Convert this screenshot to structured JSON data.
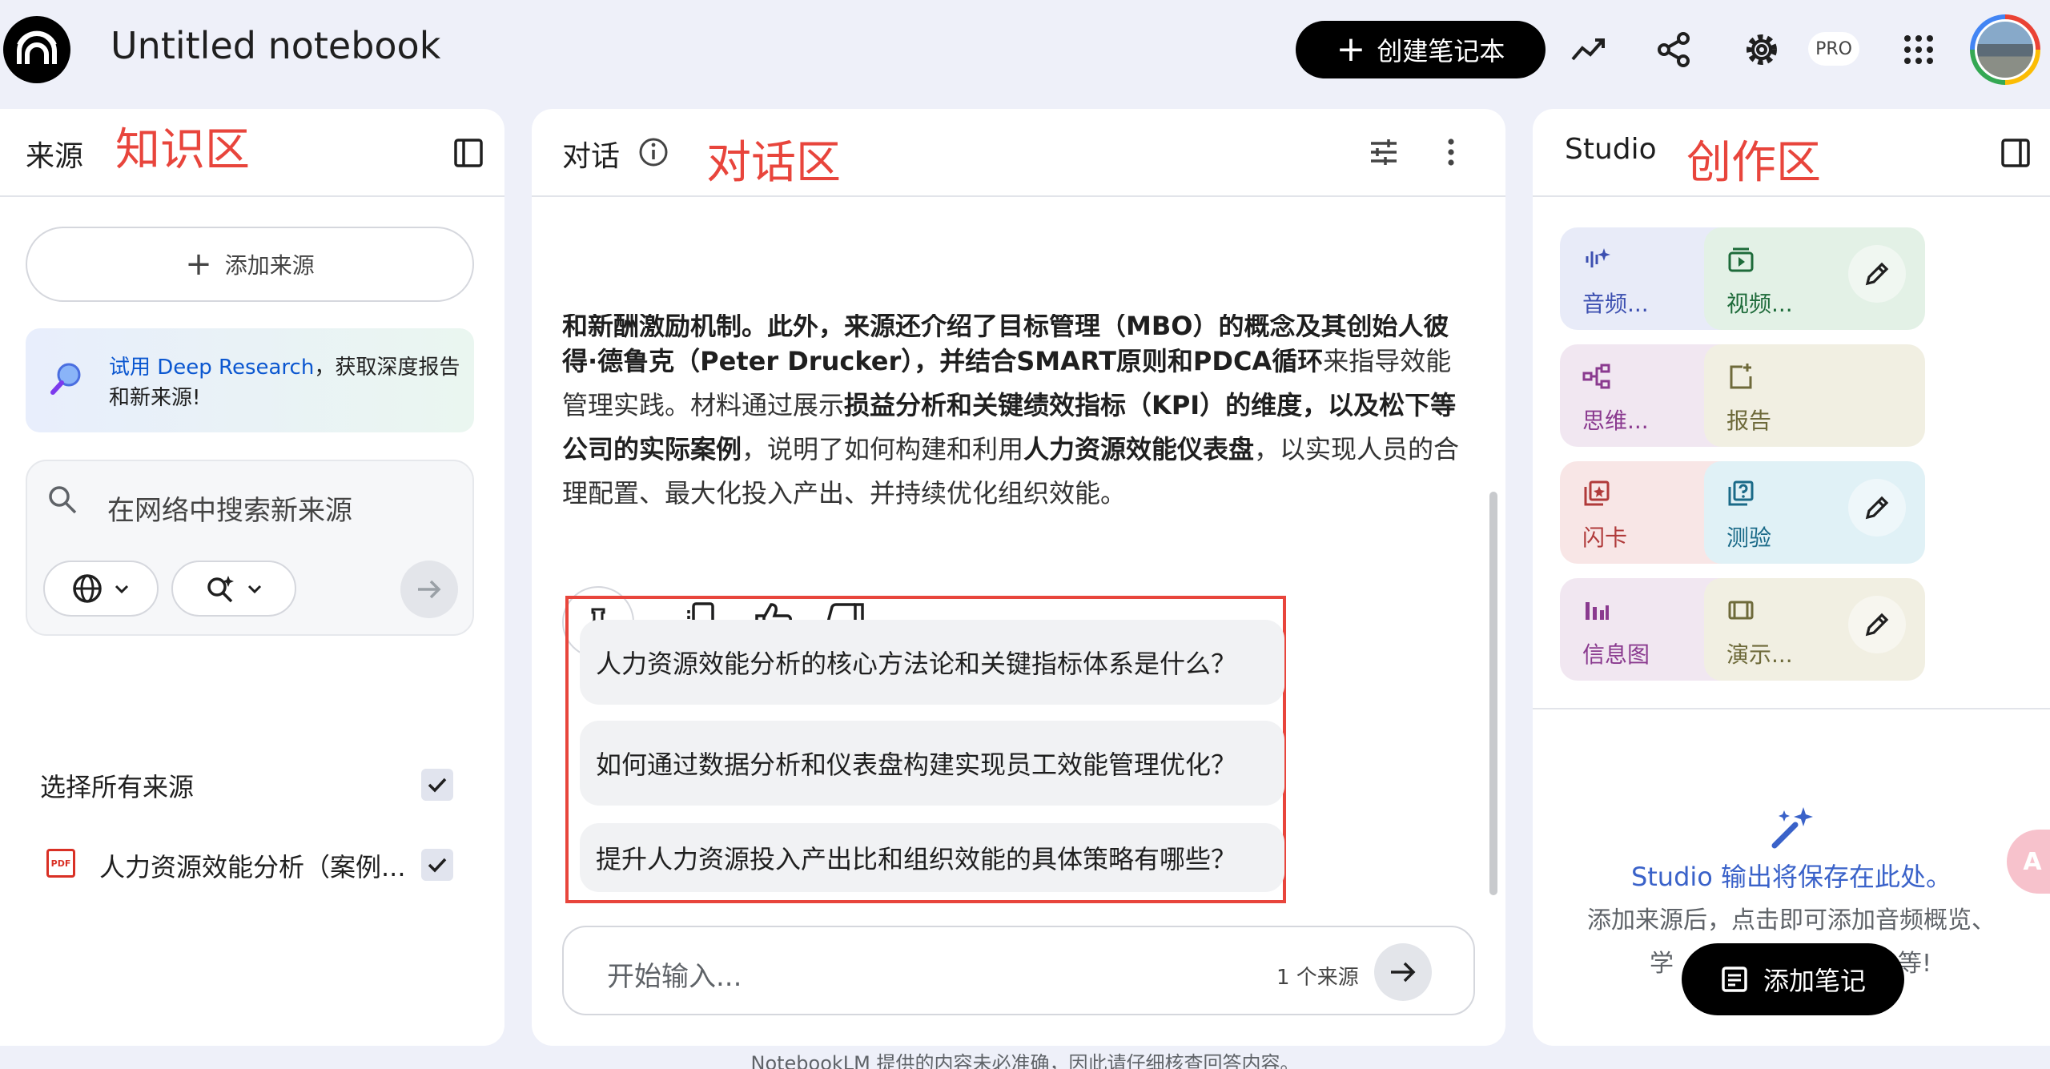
{
  "header": {
    "title": "Untitled notebook",
    "create_button": "创建笔记本",
    "pro_badge": "PRO",
    "icons": [
      "analytics-icon",
      "share-icon",
      "settings-icon",
      "apps-grid-icon"
    ]
  },
  "left_panel": {
    "title": "来源",
    "annotation": "知识区",
    "add_source": "添加来源",
    "deep_research": {
      "link": "试用 Deep Research",
      "text": "，获取深度报告和新来源!"
    },
    "search_placeholder": "在网络中搜索新来源",
    "select_all": "选择所有来源",
    "select_all_checked": true,
    "sources": [
      {
        "name": "人力资源效能分析（案例...",
        "type": "PDF",
        "checked": true
      }
    ]
  },
  "middle_panel": {
    "title": "对话",
    "annotation": "对话区",
    "answer_html_parts": {
      "line1": "和新酬激励机制。此外，来源还介绍了目标管理（MBO）的概念及其创始人彼",
      "p1": "得·德鲁克（Peter Drucker），并结合SMART原则和PDCA循环",
      "p2": "来指导效能管理实践。材料通过展示",
      "p3": "损益分析和关键绩效指标（KPI）的维度，以及松下等公司的实际案例",
      "p4": "，说明了如何构建和利用",
      "p5": "人力资源效能仪表盘",
      "p6": "，以实现人员的合理配置、最大化投入产出、并持续优化组织效能。"
    },
    "suggestions": [
      "人力资源效能分析的核心方法论和关键指标体系是什么？",
      "如何通过数据分析和仪表盘构建实现员工效能管理优化？",
      "提升人力资源投入产出比和组织效能的具体策略有哪些？"
    ],
    "input_placeholder": "开始输入...",
    "source_count": "1 个来源",
    "disclaimer": "NotebookLM 提供的内容未必准确，因此请仔细核查回答内容。"
  },
  "right_panel": {
    "title": "Studio",
    "annotation": "创作区",
    "cards": [
      {
        "label": "音频...",
        "icon": "audio-icon",
        "bg": "#e8ebf8",
        "color": "#3c4fb0"
      },
      {
        "label": "视频...",
        "icon": "video-icon",
        "bg": "#e3f1e6",
        "color": "#1e6b3a"
      },
      {
        "label": "思维...",
        "icon": "mindmap-icon",
        "bg": "#f1e7f1",
        "color": "#8a3a8f"
      },
      {
        "label": "报告",
        "icon": "report-icon",
        "bg": "#f1efe2",
        "color": "#6e6a3a"
      },
      {
        "label": "闪卡",
        "icon": "flashcard-icon",
        "bg": "#f8e6e6",
        "color": "#b03a3a"
      },
      {
        "label": "测验",
        "icon": "quiz-icon",
        "bg": "#e0f1f6",
        "color": "#1a6a88"
      },
      {
        "label": "信息图",
        "icon": "infographic-icon",
        "bg": "#f1e7f1",
        "color": "#8a3a8f"
      },
      {
        "label": "演示...",
        "icon": "slides-icon",
        "bg": "#f1efe2",
        "color": "#6e6a3a"
      }
    ],
    "empty_title": "Studio 输出将保存在此处。",
    "empty_line1": "添加来源后，点击即可添加音频概览、",
    "empty_line2a": "学",
    "empty_line2b": "等!",
    "add_note": "添加笔记"
  }
}
